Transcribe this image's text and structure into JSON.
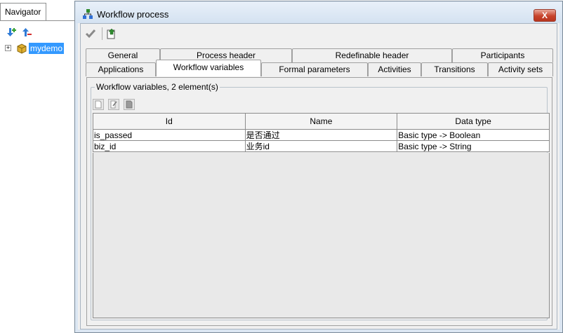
{
  "navigator": {
    "tab_label": "Navigator",
    "tree": [
      {
        "label": "mydemo",
        "selected": true
      }
    ]
  },
  "dialog": {
    "title": "Workflow process",
    "close_label": "X"
  },
  "tabs": {
    "row1": [
      "General",
      "Process header",
      "Redefinable header",
      "Participants"
    ],
    "row2": [
      "Applications",
      "Workflow variables",
      "Formal parameters",
      "Activities",
      "Transitions",
      "Activity sets"
    ],
    "selected": "Workflow variables"
  },
  "group": {
    "title": "Workflow variables, 2 element(s)"
  },
  "table": {
    "columns": [
      "Id",
      "Name",
      "Data type"
    ],
    "rows": [
      {
        "id": "is_passed",
        "name": "是否通过",
        "type": "Basic type -> Boolean"
      },
      {
        "id": "biz_id",
        "name": "业务id",
        "type": "Basic type -> String"
      }
    ]
  },
  "colors": {
    "selection": "#3399ff",
    "close": "#c7432b"
  }
}
